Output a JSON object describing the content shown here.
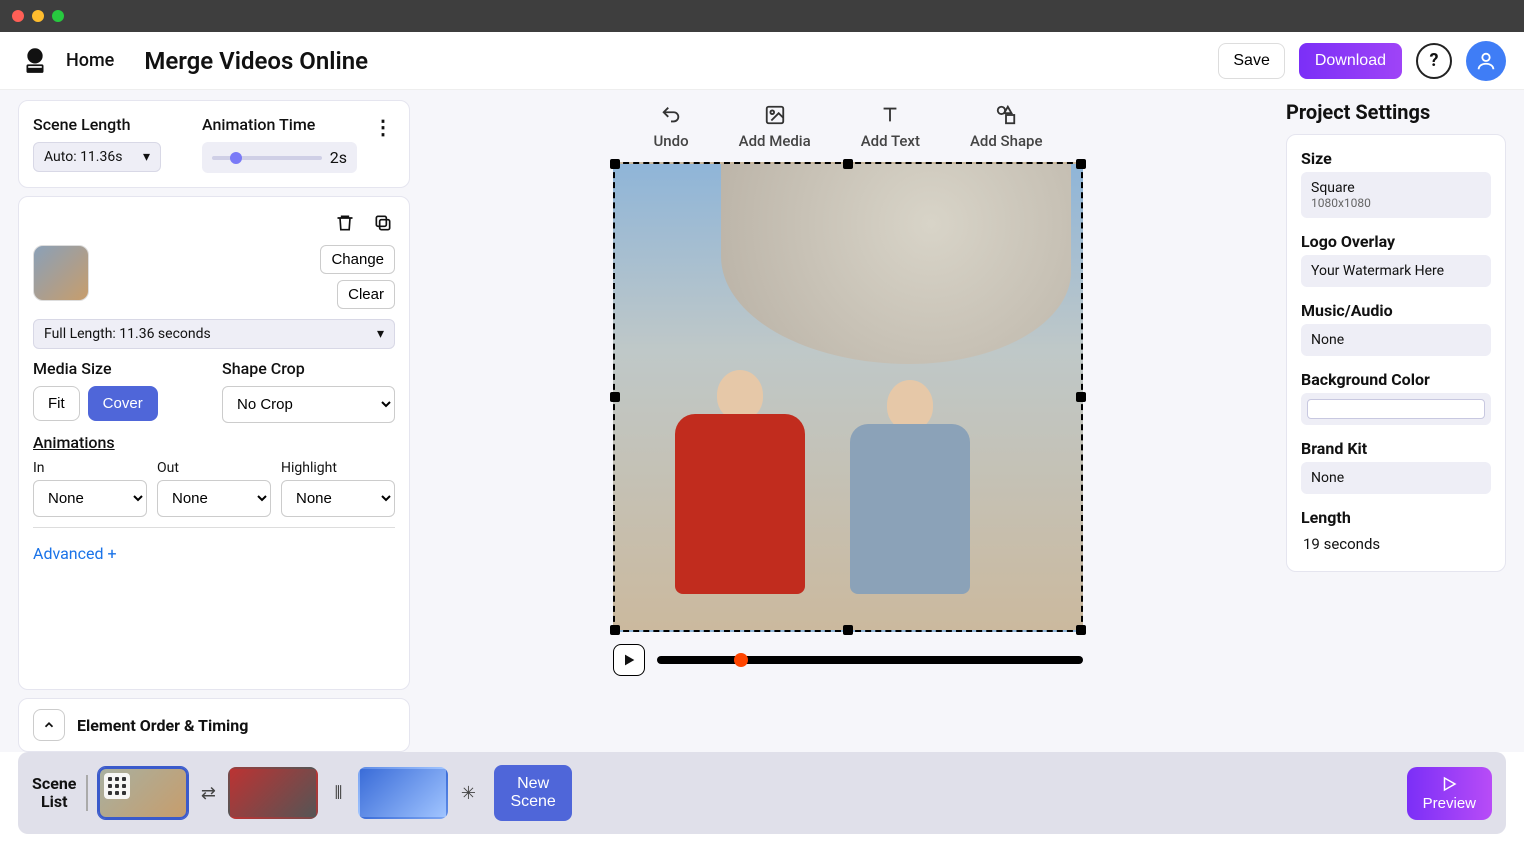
{
  "header": {
    "home": "Home",
    "title": "Merge Videos Online",
    "save": "Save",
    "download": "Download"
  },
  "leftPanel": {
    "sceneLength": {
      "label": "Scene Length",
      "value": "Auto: 11.36s"
    },
    "animationTime": {
      "label": "Animation Time",
      "value": "2s"
    },
    "change": "Change",
    "clear": "Clear",
    "fullLength": "Full Length: 11.36 seconds",
    "mediaSize": {
      "label": "Media Size",
      "fit": "Fit",
      "cover": "Cover"
    },
    "shapeCrop": {
      "label": "Shape Crop",
      "value": "No Crop"
    },
    "animations": {
      "label": "Animations",
      "inLabel": "In",
      "outLabel": "Out",
      "highlightLabel": "Highlight",
      "inValue": "None",
      "outValue": "None",
      "highlightValue": "None"
    },
    "advanced": "Advanced +",
    "elementOrder": "Element Order & Timing"
  },
  "canvasTools": {
    "undo": "Undo",
    "addMedia": "Add Media",
    "addText": "Add Text",
    "addShape": "Add Shape"
  },
  "settings": {
    "title": "Project Settings",
    "size": {
      "label": "Size",
      "preset": "Square",
      "dims": "1080x1080"
    },
    "logoOverlay": {
      "label": "Logo Overlay",
      "value": "Your Watermark Here"
    },
    "musicAudio": {
      "label": "Music/Audio",
      "value": "None"
    },
    "backgroundColor": {
      "label": "Background Color"
    },
    "brandKit": {
      "label": "Brand Kit",
      "value": "None"
    },
    "length": {
      "label": "Length",
      "value": "19 seconds"
    }
  },
  "footer": {
    "sceneList": "Scene\nList",
    "newScene": "New\nScene",
    "preview": "Preview"
  }
}
